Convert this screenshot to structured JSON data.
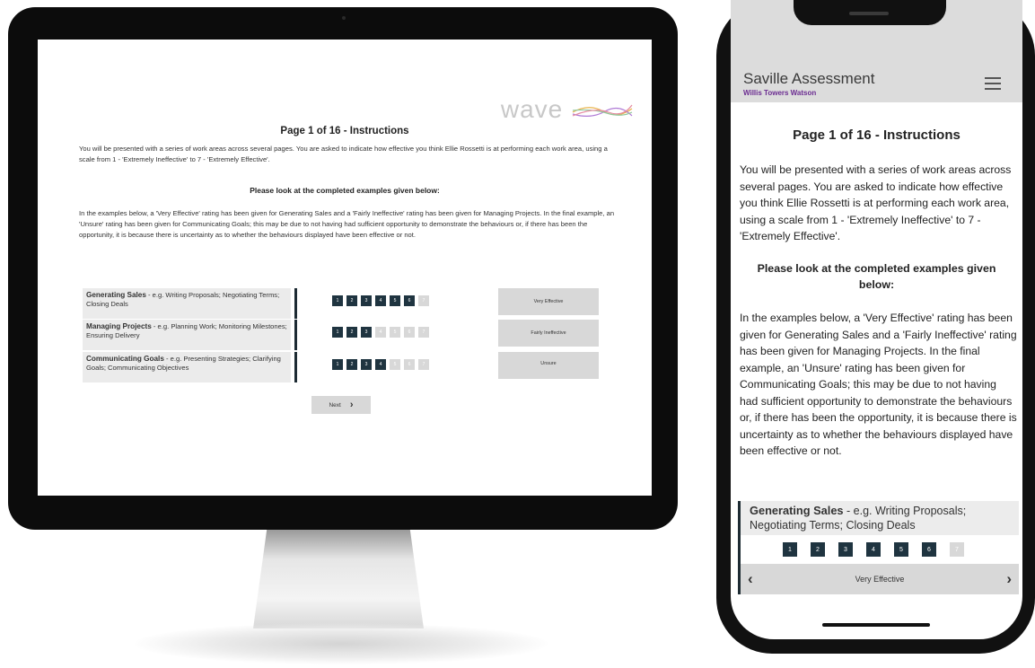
{
  "desktop": {
    "logo_text": "wave",
    "title": "Page 1 of 16 - Instructions",
    "intro": "You will be presented with a series of work areas across several pages. You are asked to indicate how effective you think Ellie Rossetti is at performing each work area, using a scale from 1 - 'Extremely Ineffective' to 7 - 'Extremely Effective'.",
    "subheading": "Please look at the completed examples given below:",
    "explanation": "In the examples below, a 'Very Effective' rating has been given for Generating Sales and a 'Fairly Ineffective' rating has been given for Managing Projects. In the final example, an 'Unsure' rating has been given for Communicating Goals; this may be due to not having had sufficient opportunity to demonstrate the behaviours or, if there has been the opportunity, it is because there is uncertainty as to whether the behaviours displayed have been effective or not.",
    "examples": [
      {
        "name": "Generating Sales",
        "desc": " - e.g. Writing Proposals; Negotiating Terms; Closing Deals",
        "rating": "Very Effective",
        "selected": 6
      },
      {
        "name": "Managing Projects",
        "desc": " - e.g. Planning Work; Monitoring Milestones; Ensuring Delivery",
        "rating": "Fairly Ineffective",
        "selected": 3
      },
      {
        "name": "Communicating Goals",
        "desc": " - e.g. Presenting Strategies; Clarifying Goals; Communicating Objectives",
        "rating": "Unsure",
        "selected": 4
      }
    ],
    "scale": [
      "1",
      "2",
      "3",
      "4",
      "5",
      "6",
      "7"
    ],
    "next_label": "Next",
    "next_icon": "chevron-right-icon"
  },
  "mobile": {
    "app_title": "Saville Assessment",
    "brand": "Willis Towers Watson",
    "menu_icon": "hamburger-menu-icon",
    "title": "Page 1 of 16 - Instructions",
    "intro": "You will be presented with a series of work areas across several pages. You are asked to indicate how effective you think Ellie Rossetti is at performing each work area, using a scale from 1 - 'Extremely Ineffective' to 7 - 'Extremely Effective'.",
    "subheading": "Please look at the completed examples given below:",
    "explanation": "In the examples below, a 'Very Effective' rating has been given for Generating Sales and a 'Fairly Ineffective' rating has been given for Managing Projects. In the final example, an 'Unsure' rating has been given for Communicating Goals; this may be due to not having had sufficient opportunity to demonstrate the behaviours or, if there has been the opportunity, it is because there is uncertainty as to whether the behaviours displayed have been effective or not.",
    "example": {
      "name": "Generating Sales",
      "desc": " - e.g. Writing Proposals; Negotiating Terms; Closing Deals",
      "rating": "Very Effective",
      "selected": 6
    },
    "scale": [
      "1",
      "2",
      "3",
      "4",
      "5",
      "6",
      "7"
    ],
    "colors": {
      "selected_cell": "#1f3440",
      "unselected_cell": "#d8d8d8",
      "brand": "#6b2c91"
    }
  }
}
